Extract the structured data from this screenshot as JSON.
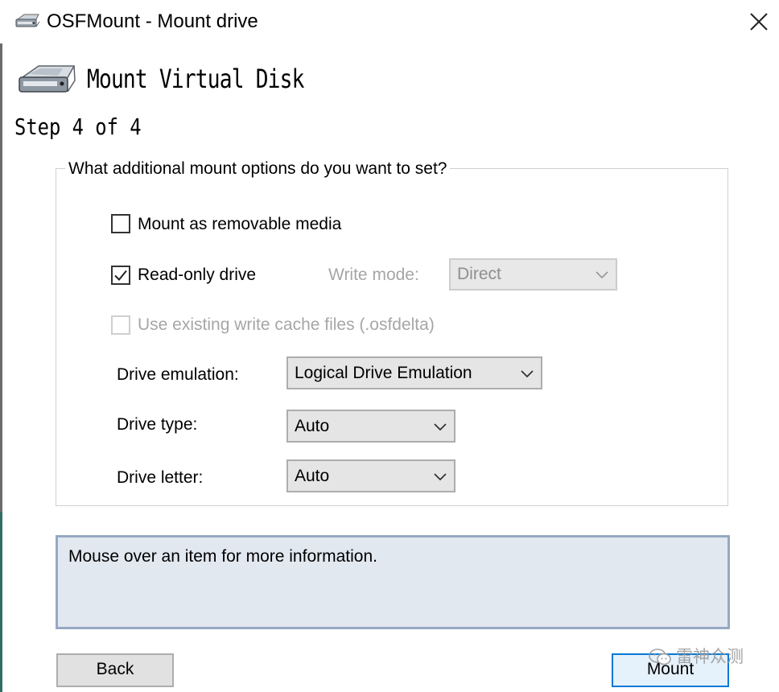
{
  "window": {
    "title": "OSFMount - Mount drive"
  },
  "header": {
    "title": "Mount Virtual Disk",
    "step": "Step 4 of 4"
  },
  "options": {
    "legend": "What additional mount options do you want to set?",
    "removable": {
      "label": "Mount as removable media",
      "checked": false
    },
    "readonly": {
      "label": "Read-only drive",
      "checked": true
    },
    "write_mode": {
      "label": "Write mode:",
      "value": "Direct",
      "enabled": false
    },
    "write_cache": {
      "label": "Use existing write cache files (.osfdelta)",
      "checked": false,
      "enabled": false
    },
    "emulation": {
      "label": "Drive emulation:",
      "value": "Logical Drive Emulation"
    },
    "type": {
      "label": "Drive type:",
      "value": "Auto"
    },
    "letter": {
      "label": "Drive letter:",
      "value": "Auto"
    }
  },
  "info": {
    "text": "Mouse over an item for more information."
  },
  "buttons": {
    "back": "Back",
    "mount": "Mount"
  },
  "watermark": {
    "text": "雷神众测",
    "icon": "wechat-icon"
  },
  "icons": {
    "app": "drive-icon",
    "close": "close-icon",
    "header": "drive-icon",
    "dropdown": "chevron-down-icon",
    "check": "checkmark-icon"
  },
  "colors": {
    "info_bg": "#e2e8f0",
    "info_border": "#96a9c2",
    "default_button_border": "#0078d7",
    "disabled_text": "#a6a6a6"
  }
}
